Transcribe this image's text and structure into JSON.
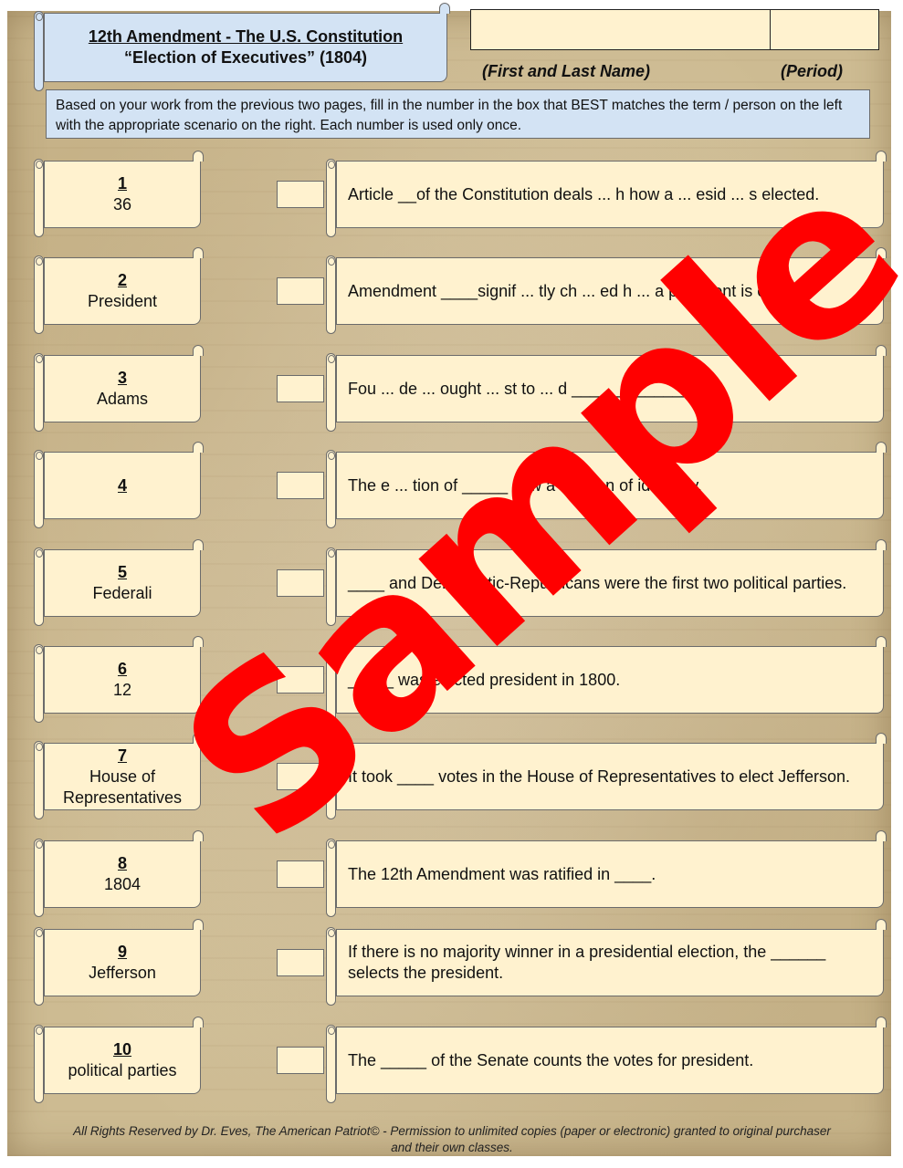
{
  "header": {
    "title_line1": "12th Amendment - The U.S. Constitution",
    "title_line2": "“Election of Executives” (1804)",
    "name_label": "(First and Last Name)",
    "period_label": "(Period)",
    "name_value": "",
    "period_value": ""
  },
  "instructions": "Based on your work from the previous two pages, fill in the number in the box that BEST matches the term / person on the left with the appropriate scenario on the right. Each number is used only once.",
  "terms": [
    {
      "number": "1",
      "label": "36"
    },
    {
      "number": "2",
      "label": "President"
    },
    {
      "number": "3",
      "label": "Adams"
    },
    {
      "number": "4",
      "label": ""
    },
    {
      "number": "5",
      "label": "Federali"
    },
    {
      "number": "6",
      "label": "12"
    },
    {
      "number": "7",
      "label": "House of Representatives"
    },
    {
      "number": "8",
      "label": "1804"
    },
    {
      "number": "9",
      "label": "Jefferson"
    },
    {
      "number": "10",
      "label": "political parties"
    }
  ],
  "scenarios": [
    {
      "text": "Article __of the Constitution deals ... h how a ... esid ... s elected.",
      "answer": ""
    },
    {
      "text": "Amendment ____signif ... tly ch ... ed h ... a president is elected.",
      "answer": ""
    },
    {
      "text": "Fou ... de ... ought ... st to ... d _____________.",
      "answer": ""
    },
    {
      "text": "The e ... tion of _____ saw a division of ideology.",
      "answer": ""
    },
    {
      "text": "____ and Democratic-Republicans were the first two political parties.",
      "answer": ""
    },
    {
      "text": "_____ was elected president in 1800.",
      "answer": ""
    },
    {
      "text": "It took ____ votes in the House of Representatives to elect Jefferson.",
      "answer": ""
    },
    {
      "text": "The 12th Amendment was ratified in ____.",
      "answer": ""
    },
    {
      "text": "If there is no majority winner in a presidential election, the ______ selects the president.",
      "answer": ""
    },
    {
      "text": "The _____ of the Senate counts the votes for president.",
      "answer": ""
    }
  ],
  "watermark": "Sample",
  "footer": "All Rights Reserved by Dr. Eves, The American Patriot© - Permission to unlimited copies (paper or electronic) granted to original purchaser and their own classes.",
  "colors": {
    "scroll_fill": "#fff2cf",
    "header_fill": "#d3e3f4",
    "watermark": "#ff0000"
  }
}
